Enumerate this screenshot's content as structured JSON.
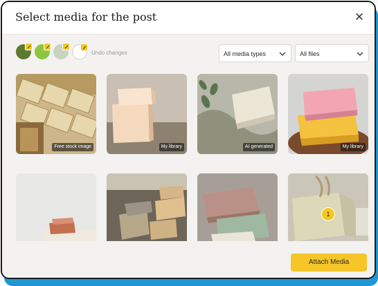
{
  "dialog": {
    "title": "Select media for the post",
    "close_icon": "close-icon"
  },
  "toolbar": {
    "swatches": [
      {
        "name": "olive",
        "color": "#5e7a2e"
      },
      {
        "name": "lime",
        "color": "#8cc63f"
      },
      {
        "name": "sage",
        "color": "#c9d4c0"
      },
      {
        "name": "white",
        "color": "#ffffff"
      }
    ],
    "undo_label": "Undo changes",
    "media_type_select": {
      "value": "All media types"
    },
    "files_select": {
      "value": "All files"
    }
  },
  "media": [
    {
      "tag": "Free stock image"
    },
    {
      "tag": "My library"
    },
    {
      "tag": "AI generated"
    },
    {
      "tag": "My library"
    },
    {
      "tag": ""
    },
    {
      "tag": ""
    },
    {
      "tag": ""
    },
    {
      "tag": "",
      "selected_index": "1"
    }
  ],
  "footer": {
    "attach_label": "Attach Media"
  },
  "colors": {
    "accent": "#f6c629",
    "frame_blue": "#1f97d5"
  }
}
